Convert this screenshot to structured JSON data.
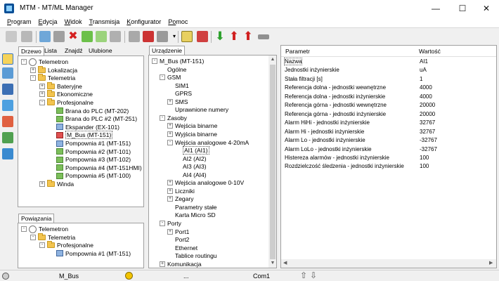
{
  "window": {
    "title": "MTM - MT/ML Manager",
    "minimize": "—",
    "maximize": "☐",
    "close": "✕"
  },
  "menu": [
    {
      "u": "P",
      "rest": "rogram"
    },
    {
      "u": "E",
      "rest": "dycja"
    },
    {
      "u": "W",
      "rest": "idok"
    },
    {
      "u": "T",
      "rest": "ransmisja"
    },
    {
      "u": "K",
      "rest": "onfigurator"
    },
    {
      "u": "Po",
      "rest": "moc",
      "swap": true
    }
  ],
  "left_tabs": {
    "drzewo": "Drzewo",
    "lista": "Lista",
    "znajdz": "Znajdź",
    "ulubione": "Ulubione"
  },
  "left_tree": [
    {
      "label": "Telemetron",
      "icon": "globe",
      "depth": 0,
      "exp": "-"
    },
    {
      "label": "Lokalizacja",
      "icon": "folder",
      "depth": 1,
      "exp": "+"
    },
    {
      "label": "Telemetria",
      "icon": "folder",
      "depth": 1,
      "exp": "-"
    },
    {
      "label": "Bateryjne",
      "icon": "folder",
      "depth": 2,
      "exp": "+"
    },
    {
      "label": "Ekonomiczne",
      "icon": "folder",
      "depth": 2,
      "exp": "+"
    },
    {
      "label": "Profesjonalne",
      "icon": "folder",
      "depth": 2,
      "exp": "-"
    },
    {
      "label": "Brana do PLC (MT-202)",
      "icon": "dev",
      "depth": 3,
      "exp": ""
    },
    {
      "label": "Brana do PLC #2 (MT-251)",
      "icon": "dev",
      "depth": 3,
      "exp": ""
    },
    {
      "label": "Ekspander (EX-101)",
      "icon": "dev blue",
      "depth": 3,
      "exp": ""
    },
    {
      "label": "M_Bus (MT-151)",
      "icon": "dev red",
      "depth": 3,
      "exp": "",
      "sel": true
    },
    {
      "label": "Pompownia #1 (MT-151)",
      "icon": "dev blue",
      "depth": 3,
      "exp": ""
    },
    {
      "label": "Pompownia #2 (MT-101)",
      "icon": "dev",
      "depth": 3,
      "exp": ""
    },
    {
      "label": "Pompownia #3 (MT-102)",
      "icon": "dev",
      "depth": 3,
      "exp": ""
    },
    {
      "label": "Pompownia #4 (MT-151HMI)",
      "icon": "dev",
      "depth": 3,
      "exp": ""
    },
    {
      "label": "Pompownia #5 (MT-100)",
      "icon": "dev",
      "depth": 3,
      "exp": ""
    },
    {
      "label": "Winda",
      "icon": "folder",
      "depth": 2,
      "exp": "+"
    }
  ],
  "relations_tab": "Powiązania",
  "relations_tree": [
    {
      "label": "Telemetron",
      "icon": "globe",
      "depth": 0,
      "exp": "-"
    },
    {
      "label": "Telemetria",
      "icon": "folder",
      "depth": 1,
      "exp": "-"
    },
    {
      "label": "Profesjonalne",
      "icon": "folder",
      "depth": 2,
      "exp": "-"
    },
    {
      "label": "Pompownia #1 (MT-151)",
      "icon": "dev blue",
      "depth": 3,
      "exp": ""
    }
  ],
  "device_tab": "Urządzenie",
  "device_tree": [
    {
      "label": "M_Bus (MT-151)",
      "depth": 0,
      "exp": "-"
    },
    {
      "label": "Ogólne",
      "depth": 1,
      "exp": ""
    },
    {
      "label": "GSM",
      "depth": 1,
      "exp": "-"
    },
    {
      "label": "SIM1",
      "depth": 2,
      "exp": ""
    },
    {
      "label": "GPRS",
      "depth": 2,
      "exp": ""
    },
    {
      "label": "SMS",
      "depth": 2,
      "exp": "+"
    },
    {
      "label": "Uprawnione numery",
      "depth": 2,
      "exp": ""
    },
    {
      "label": "Zasoby",
      "depth": 1,
      "exp": "-"
    },
    {
      "label": "Wejścia binarne",
      "depth": 2,
      "exp": "+"
    },
    {
      "label": "Wyjścia binarne",
      "depth": 2,
      "exp": "+"
    },
    {
      "label": "Wejścia analogowe 4-20mA",
      "depth": 2,
      "exp": "-"
    },
    {
      "label": "AI1 (AI1)",
      "depth": 3,
      "exp": "",
      "sel": true
    },
    {
      "label": "AI2 (AI2)",
      "depth": 3,
      "exp": ""
    },
    {
      "label": "AI3 (AI3)",
      "depth": 3,
      "exp": ""
    },
    {
      "label": "AI4 (AI4)",
      "depth": 3,
      "exp": ""
    },
    {
      "label": "Wejścia analogowe 0-10V",
      "depth": 2,
      "exp": "+"
    },
    {
      "label": "Liczniki",
      "depth": 2,
      "exp": "+"
    },
    {
      "label": "Zegary",
      "depth": 2,
      "exp": "+"
    },
    {
      "label": "Parametry stałe",
      "depth": 2,
      "exp": ""
    },
    {
      "label": "Karta Micro SD",
      "depth": 2,
      "exp": ""
    },
    {
      "label": "Porty",
      "depth": 1,
      "exp": "-"
    },
    {
      "label": "Port1",
      "depth": 2,
      "exp": "+"
    },
    {
      "label": "Port2",
      "depth": 2,
      "exp": ""
    },
    {
      "label": "Ethernet",
      "depth": 2,
      "exp": ""
    },
    {
      "label": "Tablice routingu",
      "depth": 2,
      "exp": ""
    },
    {
      "label": "Komunikacja",
      "depth": 1,
      "exp": "+"
    }
  ],
  "grid": {
    "col_param": "Parametr",
    "col_value": "Wartość",
    "rows": [
      {
        "param": "Nazwa",
        "value": "AI1",
        "sel": true
      },
      {
        "param": "Jednostki inżynierskie",
        "value": "uA"
      },
      {
        "param": "Stała filtracji [s]",
        "value": "1"
      },
      {
        "param": "Referencja dolna - jednostki wewnętrzne",
        "value": "4000"
      },
      {
        "param": "Referencja dolna - jednostki inżynierskie",
        "value": "4000"
      },
      {
        "param": "Referencja górna - jednostki wewnętrzne",
        "value": "20000"
      },
      {
        "param": "Referencja górna - jednostki inżynierskie",
        "value": "20000"
      },
      {
        "param": "Alarm HiHi - jednostki inżynierskie",
        "value": "32767"
      },
      {
        "param": "Alarm Hi - jednostki inżynierskie",
        "value": "32767"
      },
      {
        "param": "Alarm Lo - jednostki inżynierskie",
        "value": "-32767"
      },
      {
        "param": "Alarm LoLo - jednostki inżynierskie",
        "value": "-32767"
      },
      {
        "param": "Histereza alarmów - jednostki inżynierskie",
        "value": "100"
      },
      {
        "param": "Rozdzielczość śledzenia - jednostki inżynierskie",
        "value": "100"
      }
    ]
  },
  "status": {
    "device": "M_Bus",
    "ellipsis": "...",
    "port": "Com1"
  },
  "colors": {
    "accent": "#0078d7",
    "selection_red": "#e05050",
    "led": "#f3c400"
  }
}
